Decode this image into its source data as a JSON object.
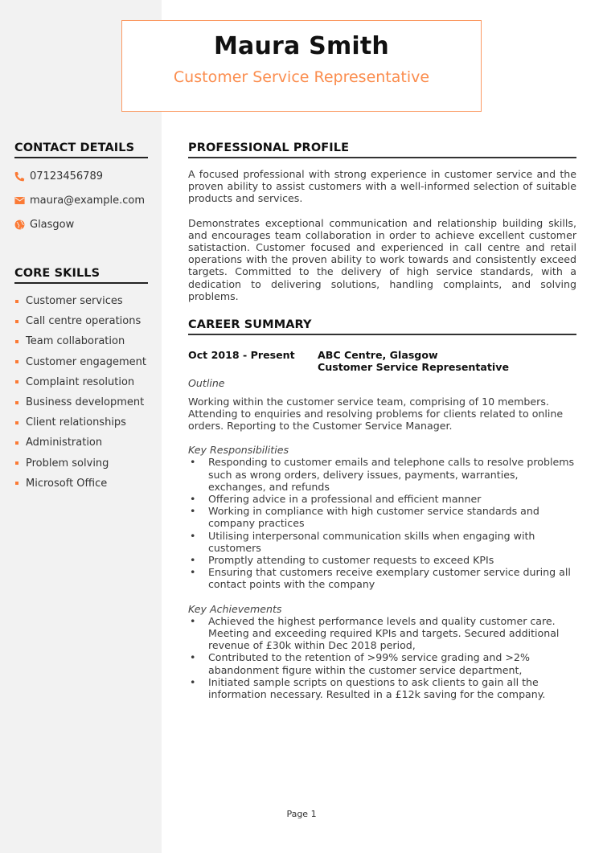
{
  "header": {
    "name": "Maura Smith",
    "title": "Customer Service Representative"
  },
  "colors": {
    "accent": "#fb8d4e",
    "sidebar_bg": "#f2f2f2"
  },
  "sidebar": {
    "contact_heading": "CONTACT DETAILS",
    "contact": [
      {
        "icon": "phone-icon",
        "value": "07123456789"
      },
      {
        "icon": "envelope-icon",
        "value": "maura@example.com"
      },
      {
        "icon": "globe-icon",
        "value": "Glasgow"
      }
    ],
    "skills_heading": "CORE SKILLS",
    "skills": [
      "Customer services",
      "Call centre operations",
      "Team collaboration",
      "Customer engagement",
      "Complaint resolution",
      "Business development",
      "Client relationships",
      "Administration",
      "Problem solving",
      "Microsoft Office"
    ]
  },
  "profile": {
    "heading": "PROFESSIONAL PROFILE",
    "paragraphs": [
      "A focused professional with strong experience in customer service and the proven ability to assist customers with a well-informed selection of suitable products and services.",
      "Demonstrates exceptional communication and relationship building skills, and encourages team collaboration in order to achieve excellent customer satistaction. Customer focused and experienced in call centre and retail operations with the proven ability to work towards and consistently exceed targets. Committed to the delivery of high service standards, with a dedication to delivering solutions, handling complaints, and solving problems."
    ]
  },
  "career": {
    "heading": "CAREER SUMMARY",
    "job": {
      "dates": "Oct 2018 - Present",
      "employer": "ABC Centre, Glasgow",
      "role": "Customer Service Representative",
      "outline_label": "Outline",
      "outline": "Working within the customer service team, comprising of 10 members. Attending to enquiries and resolving problems for clients related to online orders. Reporting to the Customer Service Manager.",
      "responsibilities_label": "Key Responsibilities",
      "responsibilities": [
        "Responding to customer emails and telephone calls to resolve problems such as wrong orders, delivery issues, payments, warranties, exchanges, and refunds",
        "Offering advice in a professional and efficient manner",
        "Working in compliance with high customer service standards and company practices",
        "Utilising interpersonal communication skills when engaging with customers",
        "Promptly attending to customer requests to exceed KPIs",
        "Ensuring that customers receive exemplary customer service during all contact points with the company"
      ],
      "achievements_label": "Key Achievements",
      "achievements": [
        "Achieved the highest performance levels and quality customer care. Meeting and exceeding required KPIs and targets. Secured additional revenue of £30k within Dec 2018 period,",
        "Contributed to the retention of >99% service grading and >2% abandonment figure within the customer service department,",
        "Initiated sample scripts on questions to ask clients to gain all the information necessary. Resulted in a £12k saving for the company."
      ]
    }
  },
  "footer": {
    "page_label": "Page 1"
  }
}
